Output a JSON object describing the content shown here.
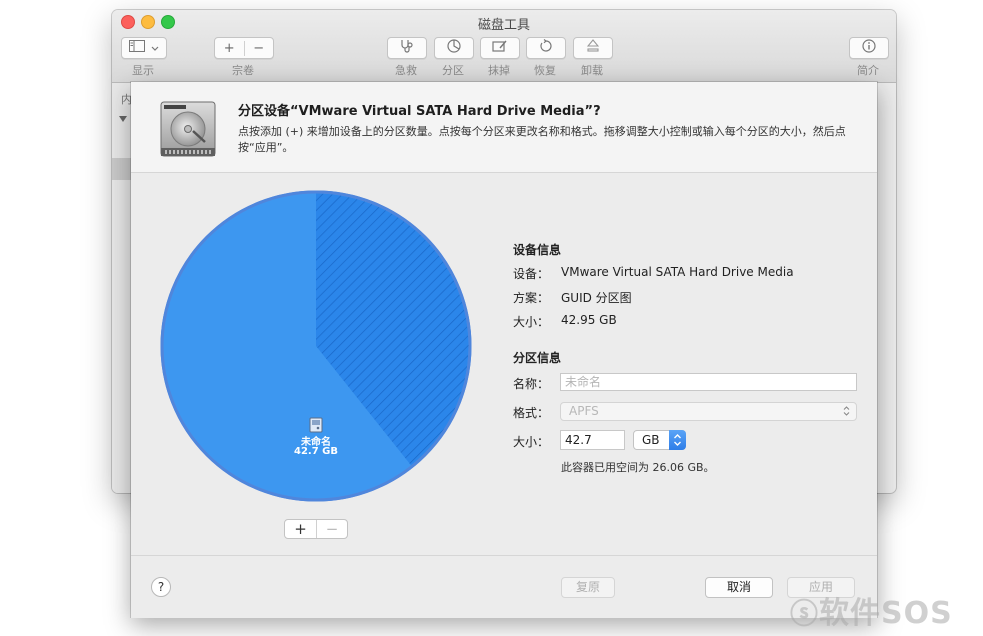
{
  "window": {
    "title": "磁盘工具",
    "toolbar": {
      "view_label": "显示",
      "volume_label": "宗卷",
      "rescue_label": "急救",
      "partition_label": "分区",
      "erase_label": "抹掉",
      "restore_label": "恢复",
      "unmount_label": "卸载",
      "info_label": "简介"
    },
    "sidebar_fragment": "内"
  },
  "sheet": {
    "title": "分区设备“VMware Virtual SATA Hard Drive Media”?",
    "description": "点按添加 (+) 来增加设备上的分区数量。点按每个分区来更改名称和格式。拖移调整大小控制或输入每个分区的大小，然后点按“应用”。",
    "pie": {
      "partition_name": "未命名",
      "partition_size": "42.7 GB",
      "used_fraction": 0.393,
      "color": "#3d97f0"
    },
    "add_button": "+",
    "remove_button": "−",
    "device_info": {
      "heading": "设备信息",
      "device_label": "设备：",
      "device_value": "VMware Virtual SATA Hard Drive Media",
      "scheme_label": "方案：",
      "scheme_value": "GUID 分区图",
      "size_label": "大小：",
      "size_value": "42.95 GB"
    },
    "partition_info": {
      "heading": "分区信息",
      "name_label": "名称：",
      "name_placeholder": "未命名",
      "format_label": "格式：",
      "format_value": "APFS",
      "size_label": "大小：",
      "size_value": "42.7",
      "size_unit": "GB",
      "container_note": "此容器已用空间为 26.06 GB。"
    },
    "footer": {
      "help": "?",
      "revert": "复原",
      "cancel": "取消",
      "apply": "应用"
    }
  },
  "watermark": "软件SOS"
}
